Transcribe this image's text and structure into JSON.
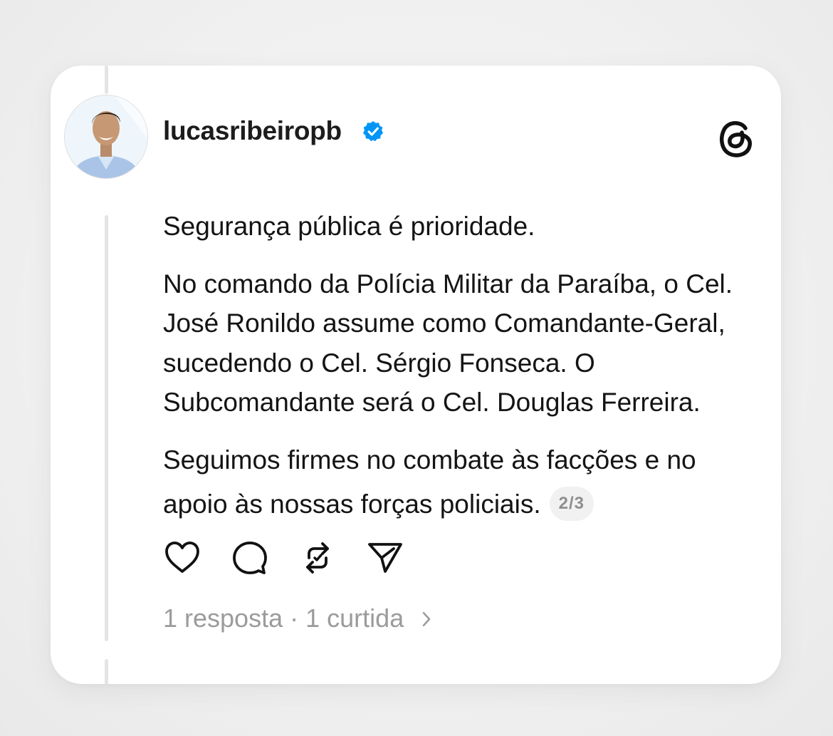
{
  "post": {
    "username": "lucasribeiropb",
    "paragraphs": [
      "Segurança pública é prioridade.",
      "No comando da Polícia Militar da Paraíba, o Cel. José Ronildo assume como Comandante-Geral, sucedendo o Cel. Sérgio Fonseca. O Subcomandante será o Cel. Douglas Ferreira."
    ],
    "paragraph3_line1": "Seguimos firmes no combate às facções e no",
    "paragraph3_line2": "apoio às nossas forças policiais.",
    "page_indicator": "2/3",
    "stats": {
      "replies": "1 resposta",
      "separator": "·",
      "likes": "1 curtida"
    }
  },
  "icons": {
    "verified": "verified-badge-icon",
    "brand": "threads-logo-icon",
    "like": "heart-icon",
    "reply": "comment-icon",
    "repost": "repost-icon",
    "share": "send-icon",
    "more": "chevron-right-icon"
  },
  "colors": {
    "verified_blue": "#0095f6",
    "text_primary": "#141414",
    "text_secondary": "#9b9b9b",
    "card_background": "#ffffff",
    "page_background": "#efefef"
  }
}
